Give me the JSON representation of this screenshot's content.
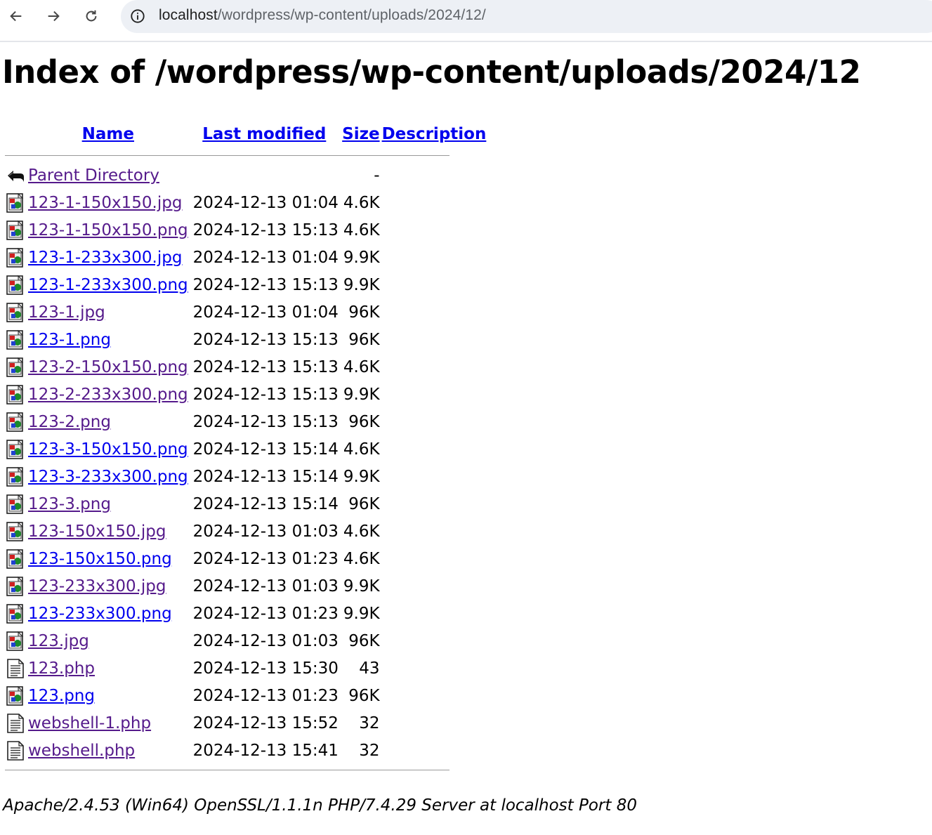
{
  "browser": {
    "url_host": "localhost",
    "url_path": "/wordpress/wp-content/uploads/2024/12/"
  },
  "page": {
    "title": "Index of /wordpress/wp-content/uploads/2024/12",
    "headers": {
      "name": "Name",
      "last_modified": "Last modified",
      "size": "Size",
      "description": "Description"
    },
    "parent": {
      "label": "Parent Directory",
      "size": "-"
    },
    "rows": [
      {
        "name": "123-1-150x150.jpg",
        "modified": "2024-12-13 01:04",
        "size": "4.6K",
        "icon": "image-icon",
        "visited": true
      },
      {
        "name": "123-1-150x150.png",
        "modified": "2024-12-13 15:13",
        "size": "4.6K",
        "icon": "image-icon",
        "visited": true
      },
      {
        "name": "123-1-233x300.jpg",
        "modified": "2024-12-13 01:04",
        "size": "9.9K",
        "icon": "image-icon",
        "visited": false
      },
      {
        "name": "123-1-233x300.png",
        "modified": "2024-12-13 15:13",
        "size": "9.9K",
        "icon": "image-icon",
        "visited": false
      },
      {
        "name": "123-1.jpg",
        "modified": "2024-12-13 01:04",
        "size": "96K",
        "icon": "image-icon",
        "visited": true
      },
      {
        "name": "123-1.png",
        "modified": "2024-12-13 15:13",
        "size": "96K",
        "icon": "image-icon",
        "visited": false
      },
      {
        "name": "123-2-150x150.png",
        "modified": "2024-12-13 15:13",
        "size": "4.6K",
        "icon": "image-icon",
        "visited": true
      },
      {
        "name": "123-2-233x300.png",
        "modified": "2024-12-13 15:13",
        "size": "9.9K",
        "icon": "image-icon",
        "visited": true
      },
      {
        "name": "123-2.png",
        "modified": "2024-12-13 15:13",
        "size": "96K",
        "icon": "image-icon",
        "visited": true
      },
      {
        "name": "123-3-150x150.png",
        "modified": "2024-12-13 15:14",
        "size": "4.6K",
        "icon": "image-icon",
        "visited": false
      },
      {
        "name": "123-3-233x300.png",
        "modified": "2024-12-13 15:14",
        "size": "9.9K",
        "icon": "image-icon",
        "visited": false
      },
      {
        "name": "123-3.png",
        "modified": "2024-12-13 15:14",
        "size": "96K",
        "icon": "image-icon",
        "visited": true
      },
      {
        "name": "123-150x150.jpg",
        "modified": "2024-12-13 01:03",
        "size": "4.6K",
        "icon": "image-icon",
        "visited": true
      },
      {
        "name": "123-150x150.png",
        "modified": "2024-12-13 01:23",
        "size": "4.6K",
        "icon": "image-icon",
        "visited": false
      },
      {
        "name": "123-233x300.jpg",
        "modified": "2024-12-13 01:03",
        "size": "9.9K",
        "icon": "image-icon",
        "visited": true
      },
      {
        "name": "123-233x300.png",
        "modified": "2024-12-13 01:23",
        "size": "9.9K",
        "icon": "image-icon",
        "visited": false
      },
      {
        "name": "123.jpg",
        "modified": "2024-12-13 01:03",
        "size": "96K",
        "icon": "image-icon",
        "visited": true
      },
      {
        "name": "123.php",
        "modified": "2024-12-13 15:30",
        "size": "43",
        "icon": "text-file-icon",
        "visited": true
      },
      {
        "name": "123.png",
        "modified": "2024-12-13 01:23",
        "size": "96K",
        "icon": "image-icon",
        "visited": false
      },
      {
        "name": "webshell-1.php",
        "modified": "2024-12-13 15:52",
        "size": "32",
        "icon": "text-file-icon",
        "visited": true
      },
      {
        "name": "webshell.php",
        "modified": "2024-12-13 15:41",
        "size": "32",
        "icon": "text-file-icon",
        "visited": true
      }
    ],
    "footer": "Apache/2.4.53 (Win64) OpenSSL/1.1.1n PHP/7.4.29 Server at localhost Port 80"
  },
  "colors": {
    "link": "#0000ee",
    "visited": "#551a8b",
    "omnibox_bg": "#edf0f5"
  }
}
